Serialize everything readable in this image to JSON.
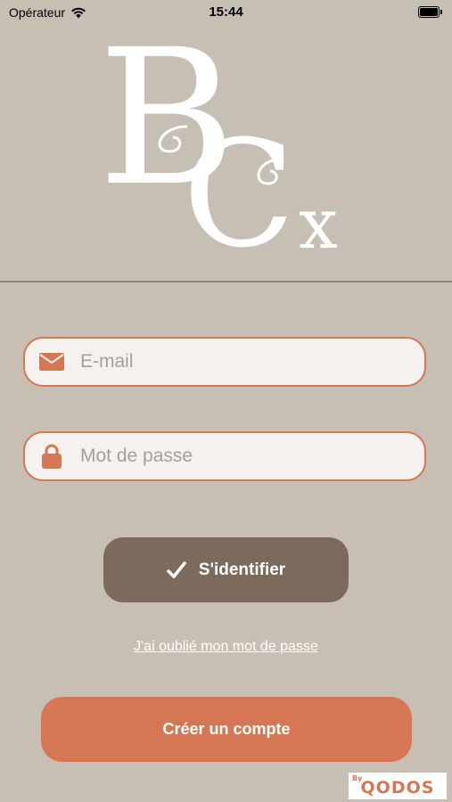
{
  "status_bar": {
    "carrier": "Opérateur",
    "time": "15:44"
  },
  "logo": {
    "letter_b": "B",
    "letter_c": "C",
    "letter_x": "x"
  },
  "form": {
    "email_placeholder": "E-mail",
    "email_value": "",
    "email_icon": "envelope-icon",
    "password_placeholder": "Mot de passe",
    "password_value": "",
    "password_icon": "lock-icon"
  },
  "actions": {
    "login_label": "S'identifier",
    "login_icon": "checkmark-icon",
    "forgot_password": "J'ai oublié mon mot de passe",
    "create_account": "Créer un compte"
  },
  "branding": {
    "by": "By",
    "name": "QODOS"
  },
  "colors": {
    "background": "#c8bfb4",
    "accent": "#d57754",
    "primary_button": "#7c6a5c",
    "field_background": "#f5f1ee"
  }
}
